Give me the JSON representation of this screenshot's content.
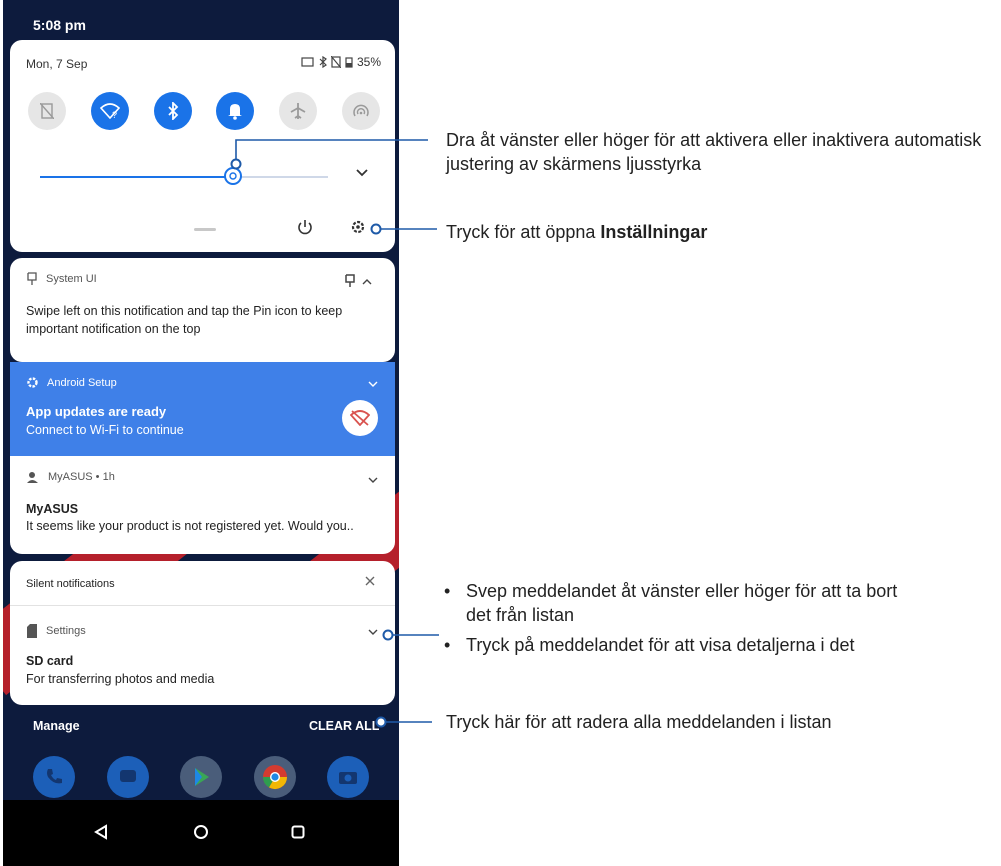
{
  "status": {
    "time": "5:08 pm"
  },
  "quick_settings": {
    "date": "Mon, 7 Sep",
    "battery": "35%",
    "tiles": [
      {
        "name": "sim",
        "active": false
      },
      {
        "name": "wifi",
        "active": true
      },
      {
        "name": "bluetooth",
        "active": true
      },
      {
        "name": "notifications",
        "active": true
      },
      {
        "name": "airplane",
        "active": false
      },
      {
        "name": "hotspot",
        "active": false
      }
    ],
    "brightness": 0.67
  },
  "notifications": {
    "system_ui": {
      "app": "System UI",
      "text": "Swipe left on this notification and tap the Pin icon to keep important notification on the top"
    },
    "android_setup": {
      "app": "Android Setup",
      "title": "App updates are ready",
      "text": "Connect to Wi-Fi to continue"
    },
    "myasus": {
      "app": "MyASUS • 1h",
      "title": "MyASUS",
      "text": "It seems like your product is not registered yet. Would you.."
    },
    "silent": {
      "header": "Silent notifications",
      "app": "Settings",
      "title": "SD card",
      "text": "For transferring photos and media"
    }
  },
  "footer": {
    "manage": "Manage",
    "clear_all": "CLEAR ALL"
  },
  "callouts": {
    "brightness": "Dra åt vänster eller höger för att aktivera eller inaktivera automatisk justering av skärmens ljusstyrka",
    "settings_prefix": "Tryck för att öppna ",
    "settings_bold": "Inställningar",
    "swipe": "Svep meddelandet åt vänster eller höger för att ta bort det från listan",
    "tap": "Tryck på meddelandet för att visa detaljerna i det",
    "clear": "Tryck här för att radera alla meddelanden i listan"
  }
}
